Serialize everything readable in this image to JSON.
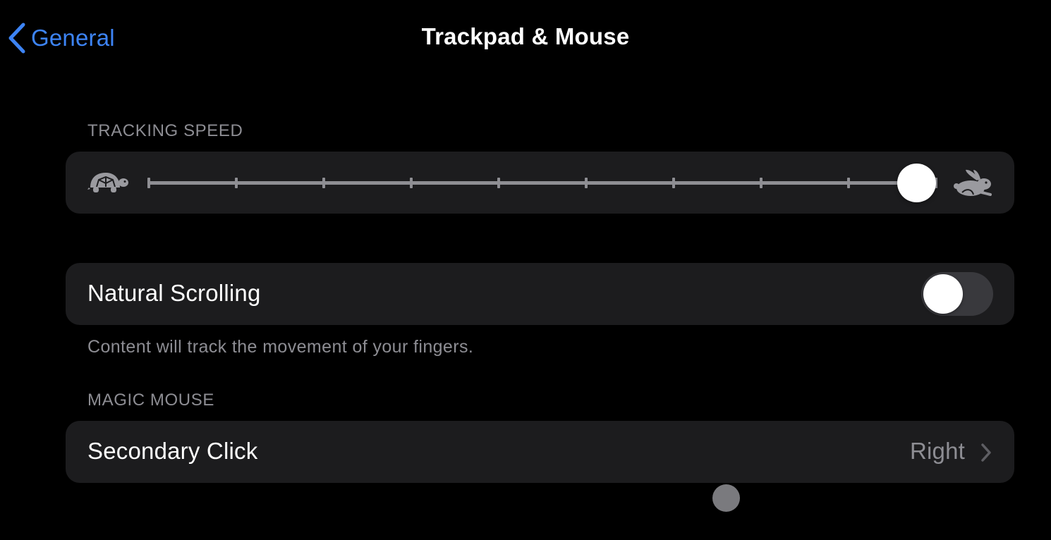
{
  "nav": {
    "back_label": "General",
    "title": "Trackpad & Mouse",
    "accent_color": "#3d84f5"
  },
  "tracking_speed": {
    "header": "TRACKING SPEED",
    "slow_icon": "turtle-icon",
    "fast_icon": "rabbit-icon",
    "tick_count": 10,
    "value_fraction": 1.0
  },
  "natural_scrolling": {
    "label": "Natural Scrolling",
    "enabled": false,
    "footer": "Content will track the movement of your fingers."
  },
  "magic_mouse": {
    "header": "MAGIC MOUSE",
    "secondary_click": {
      "label": "Secondary Click",
      "value": "Right",
      "icon": "chevron-right-icon"
    }
  },
  "pointer": {
    "icon": "pointer-cursor-icon"
  }
}
